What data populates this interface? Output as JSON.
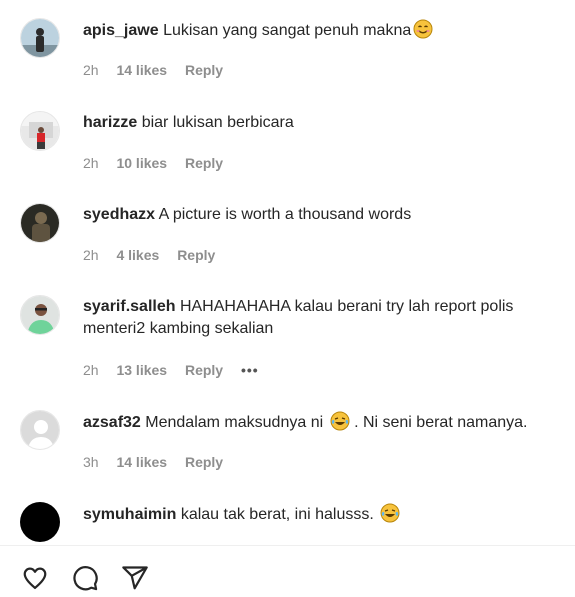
{
  "comments": [
    {
      "username": "apis_jawe",
      "text": "Lukisan yang sangat penuh makna",
      "emoji": "smile-emoji",
      "time": "2h",
      "likes": "14 likes",
      "reply": "Reply"
    },
    {
      "username": "harizze",
      "text": "biar lukisan berbicara",
      "time": "2h",
      "likes": "10 likes",
      "reply": "Reply"
    },
    {
      "username": "syedhazx",
      "text": "A picture is worth a thousand words",
      "time": "2h",
      "likes": "4 likes",
      "reply": "Reply"
    },
    {
      "username": "syarif.salleh",
      "text": "HAHAHAHAHA kalau berani try lah report polis menteri2 kambing sekalian",
      "time": "2h",
      "likes": "13 likes",
      "reply": "Reply",
      "more": "•••"
    },
    {
      "username": "azsaf32",
      "text_before": "Mendalam maksudnya ni",
      "emoji": "tears-of-joy-emoji",
      "text_after": ". Ni seni berat namanya.",
      "time": "3h",
      "likes": "14 likes",
      "reply": "Reply"
    },
    {
      "username": "symuhaimin",
      "text": "kalau tak berat, ini halusss.",
      "emoji": "tears-of-joy-emoji"
    }
  ],
  "actions": [
    "heart-icon",
    "comment-icon",
    "share-icon"
  ],
  "colors": {
    "text": "#262626",
    "muted": "#8e8e8e",
    "emoji": "#f7c33d"
  }
}
